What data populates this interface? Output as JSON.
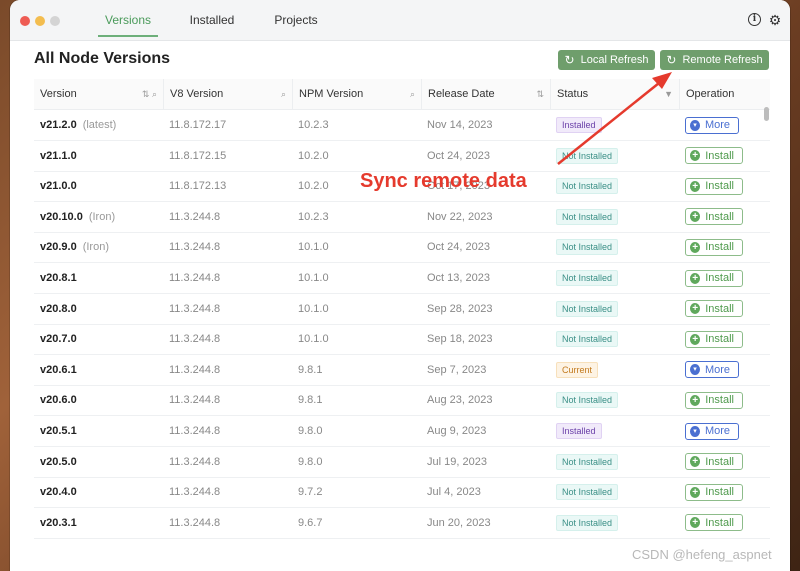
{
  "tabs": [
    {
      "label": "Versions",
      "active": true
    },
    {
      "label": "Installed",
      "active": false
    },
    {
      "label": "Projects",
      "active": false
    }
  ],
  "toolbar_icons": [
    "info-icon",
    "gear-icon"
  ],
  "page_title": "All Node Versions",
  "buttons": {
    "local_refresh": "Local Refresh",
    "remote_refresh": "Remote Refresh"
  },
  "columns": [
    "Version",
    "V8 Version",
    "NPM Version",
    "Release Date",
    "Status",
    "Operation"
  ],
  "rows": [
    {
      "version": "v21.2.0",
      "tag": "(latest)",
      "v8": "11.8.172.17",
      "npm": "10.2.3",
      "date": "Nov 14, 2023",
      "status": "Installed",
      "op": "More"
    },
    {
      "version": "v21.1.0",
      "tag": "",
      "v8": "11.8.172.15",
      "npm": "10.2.0",
      "date": "Oct 24, 2023",
      "status": "Not Installed",
      "op": "Install"
    },
    {
      "version": "v21.0.0",
      "tag": "",
      "v8": "11.8.172.13",
      "npm": "10.2.0",
      "date": "Oct 17, 2023",
      "status": "Not Installed",
      "op": "Install"
    },
    {
      "version": "v20.10.0",
      "tag": "(Iron)",
      "v8": "11.3.244.8",
      "npm": "10.2.3",
      "date": "Nov 22, 2023",
      "status": "Not Installed",
      "op": "Install"
    },
    {
      "version": "v20.9.0",
      "tag": "(Iron)",
      "v8": "11.3.244.8",
      "npm": "10.1.0",
      "date": "Oct 24, 2023",
      "status": "Not Installed",
      "op": "Install"
    },
    {
      "version": "v20.8.1",
      "tag": "",
      "v8": "11.3.244.8",
      "npm": "10.1.0",
      "date": "Oct 13, 2023",
      "status": "Not Installed",
      "op": "Install"
    },
    {
      "version": "v20.8.0",
      "tag": "",
      "v8": "11.3.244.8",
      "npm": "10.1.0",
      "date": "Sep 28, 2023",
      "status": "Not Installed",
      "op": "Install"
    },
    {
      "version": "v20.7.0",
      "tag": "",
      "v8": "11.3.244.8",
      "npm": "10.1.0",
      "date": "Sep 18, 2023",
      "status": "Not Installed",
      "op": "Install"
    },
    {
      "version": "v20.6.1",
      "tag": "",
      "v8": "11.3.244.8",
      "npm": "9.8.1",
      "date": "Sep 7, 2023",
      "status": "Current",
      "op": "More"
    },
    {
      "version": "v20.6.0",
      "tag": "",
      "v8": "11.3.244.8",
      "npm": "9.8.1",
      "date": "Aug 23, 2023",
      "status": "Not Installed",
      "op": "Install"
    },
    {
      "version": "v20.5.1",
      "tag": "",
      "v8": "11.3.244.8",
      "npm": "9.8.0",
      "date": "Aug 9, 2023",
      "status": "Installed",
      "op": "More"
    },
    {
      "version": "v20.5.0",
      "tag": "",
      "v8": "11.3.244.8",
      "npm": "9.8.0",
      "date": "Jul 19, 2023",
      "status": "Not Installed",
      "op": "Install"
    },
    {
      "version": "v20.4.0",
      "tag": "",
      "v8": "11.3.244.8",
      "npm": "9.7.2",
      "date": "Jul 4, 2023",
      "status": "Not Installed",
      "op": "Install"
    },
    {
      "version": "v20.3.1",
      "tag": "",
      "v8": "11.3.244.8",
      "npm": "9.6.7",
      "date": "Jun 20, 2023",
      "status": "Not Installed",
      "op": "Install"
    }
  ],
  "annotation": "Sync remote data",
  "watermark": "CSDN @hefeng_aspnet",
  "colors": {
    "accent_green": "#6f9e6c",
    "annotation_red": "#e53a2d",
    "more_blue": "#4a6fd1"
  }
}
